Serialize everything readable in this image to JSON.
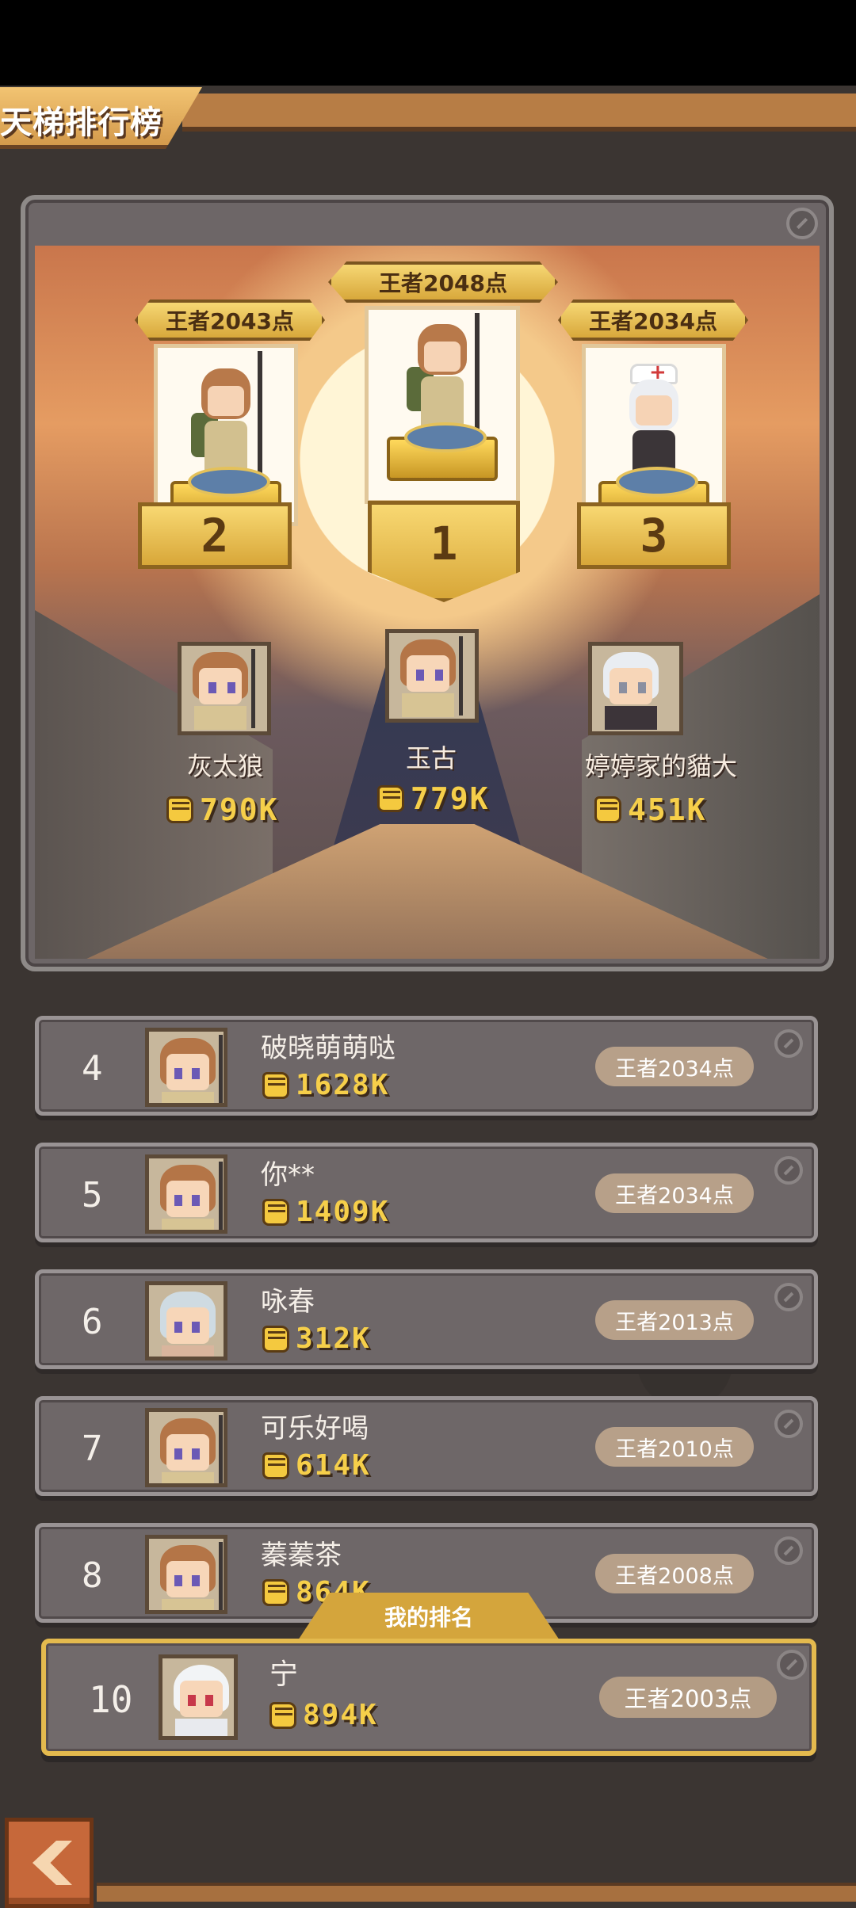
{
  "header": {
    "title": "天梯排行榜"
  },
  "podium": [
    {
      "rank": "1",
      "score": "王者2048点",
      "name": "玉古",
      "power": "779K"
    },
    {
      "rank": "2",
      "score": "王者2043点",
      "name": "灰太狼",
      "power": "790K"
    },
    {
      "rank": "3",
      "score": "王者2034点",
      "name": "婷婷家的貓大",
      "power": "451K"
    }
  ],
  "list": [
    {
      "rank": "4",
      "name": "破晓萌萌哒",
      "power": "1628K",
      "score": "王者2034点"
    },
    {
      "rank": "5",
      "name": "你**",
      "power": "1409K",
      "score": "王者2034点"
    },
    {
      "rank": "6",
      "name": "咏春",
      "power": "312K",
      "score": "王者2013点"
    },
    {
      "rank": "7",
      "name": "可乐好喝",
      "power": "614K",
      "score": "王者2010点"
    },
    {
      "rank": "8",
      "name": "蓁蓁茶",
      "power": "864K",
      "score": "王者2008点"
    }
  ],
  "my_rank": {
    "tab_label": "我的排名",
    "rank": "10",
    "name": "宁",
    "power": "894K",
    "score": "王者2003点"
  },
  "colors": {
    "gold": "#f4c93f",
    "panel": "#6e6768",
    "accent_border": "#e4ba4e",
    "back_button": "#c6683a"
  },
  "icons": {
    "power": "fist-icon",
    "back": "chevron-left-icon",
    "row_action": "settings-circle-icon"
  }
}
